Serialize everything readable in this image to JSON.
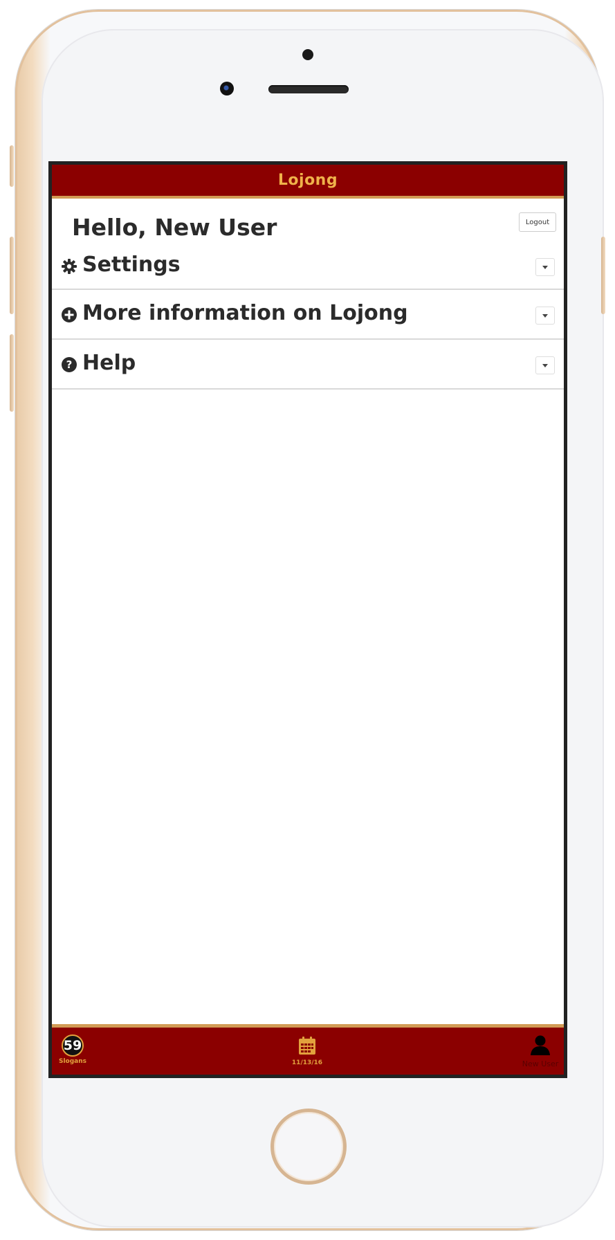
{
  "app": {
    "title": "Lojong"
  },
  "account": {
    "greeting": "Hello, New User",
    "logout_label": "Logout"
  },
  "sections": [
    {
      "label": "Settings",
      "icon": "gear-icon"
    },
    {
      "label": "More information on Lojong",
      "icon": "plus-circle-icon"
    },
    {
      "label": "Help",
      "icon": "question-circle-icon"
    }
  ],
  "tabs": [
    {
      "label": "Slogans",
      "badge": "59",
      "icon": "slogan-count-badge"
    },
    {
      "label": "11/13/16",
      "icon": "calendar-icon"
    },
    {
      "label": "New User",
      "icon": "user-icon"
    }
  ],
  "colors": {
    "brand": "#8b0000",
    "accent": "#f0b24a",
    "border": "#d29b55"
  }
}
